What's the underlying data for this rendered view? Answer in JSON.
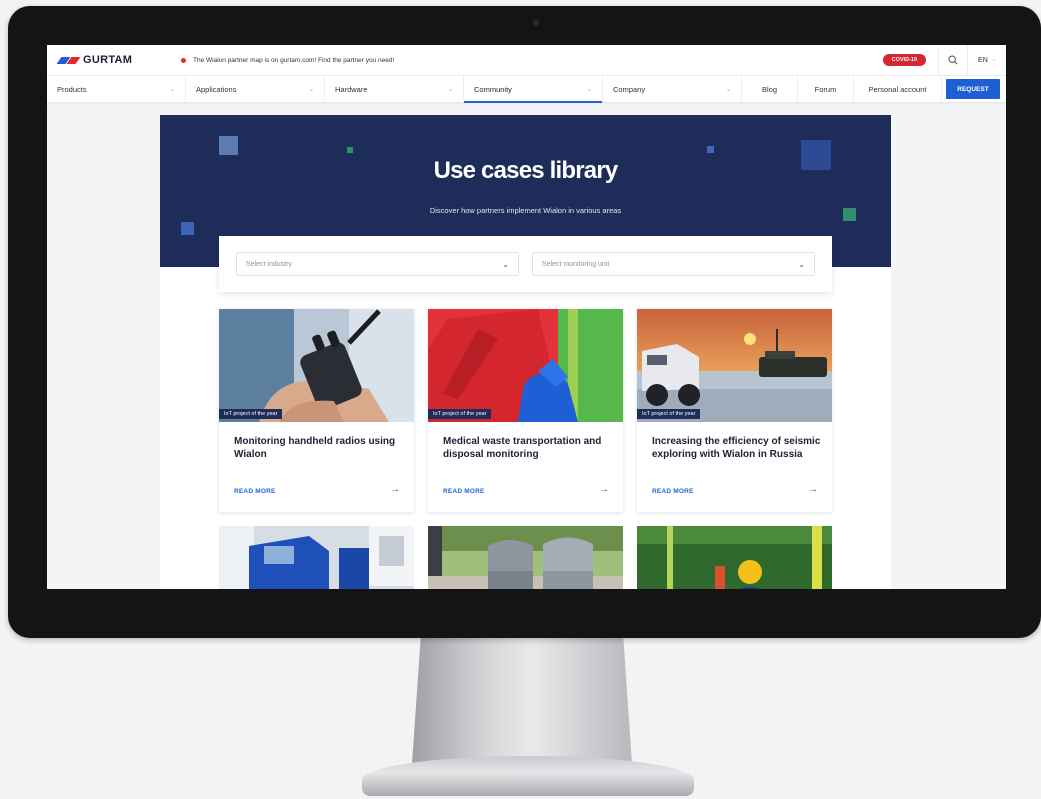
{
  "topbar": {
    "logo_text": "GURTAM",
    "announcement": "The Wialon partner map is on gurtam.com! Find the partner you need!",
    "covid_badge": "COVID-19",
    "language": "EN"
  },
  "nav": {
    "items": [
      {
        "label": "Products",
        "has_dropdown": true
      },
      {
        "label": "Applications",
        "has_dropdown": true
      },
      {
        "label": "Hardware",
        "has_dropdown": true
      },
      {
        "label": "Community",
        "has_dropdown": true,
        "active": true
      },
      {
        "label": "Company",
        "has_dropdown": true
      },
      {
        "label": "Blog"
      },
      {
        "label": "Forum"
      },
      {
        "label": "Personal account"
      }
    ],
    "request_label": "REQUEST"
  },
  "hero": {
    "title": "Use cases library",
    "subtitle": "Discover how partners implement Wialon in various areas"
  },
  "filters": {
    "industry_placeholder": "Select industry",
    "unit_placeholder": "Select monitoring unit"
  },
  "cards": [
    {
      "tag": "IoT project of the year",
      "title": "Monitoring handheld radios using Wialon",
      "link": "READ MORE"
    },
    {
      "tag": "IoT project of the year",
      "title": "Medical waste transportation and disposal monitoring",
      "link": "READ MORE"
    },
    {
      "tag": "IoT project of the year",
      "title": "Increasing the efficiency of seismic exploring with Wialon in Russia",
      "link": "READ MORE"
    }
  ],
  "colors": {
    "brand_blue": "#1f5fd4",
    "hero_navy": "#1d2c59",
    "covid_red": "#d6262f",
    "link_blue": "#2563d9"
  },
  "icons": {
    "search": "search-icon",
    "chevron": "chevron-down-icon",
    "arrow": "arrow-right-icon"
  }
}
